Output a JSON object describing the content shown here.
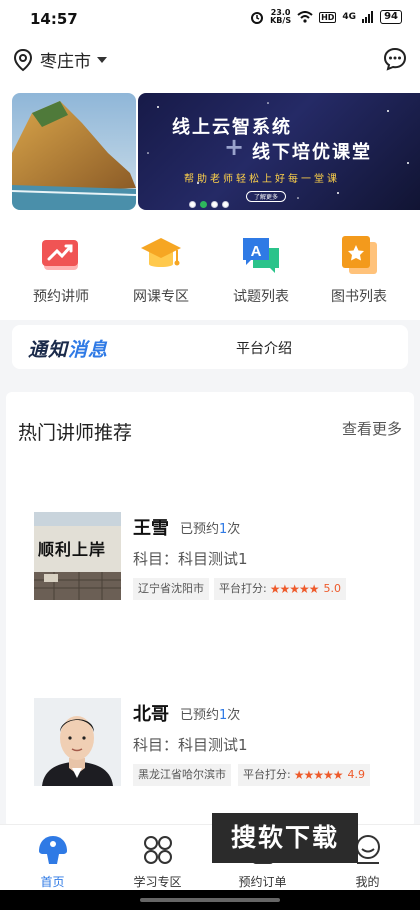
{
  "status_bar": {
    "time": "14:57",
    "net_speed_value": "23.0",
    "net_speed_unit": "KB/S",
    "hd": "HD",
    "signal": "4G",
    "battery": "94"
  },
  "header": {
    "city": "枣庄市",
    "icons": [
      "location-pin-icon",
      "caret-down-icon",
      "chat-bubble-icon"
    ]
  },
  "banner": {
    "title_line1": "线上云智系统",
    "title_line2": "线下培优课堂",
    "subtitle": "帮助老师轻松上好每一堂课",
    "button": "了解更多",
    "slide_count": 4,
    "active_slide": 1
  },
  "quick_nav": {
    "items": [
      {
        "label": "预约讲师",
        "icon": "trend-chart-icon",
        "color": "#f05454"
      },
      {
        "label": "网课专区",
        "icon": "graduation-cap-icon",
        "color": "#f6a623"
      },
      {
        "label": "试题列表",
        "icon": "quiz-chat-icon",
        "color": "#2f7ae5"
      },
      {
        "label": "图书列表",
        "icon": "book-star-icon",
        "color": "#f39a1c"
      }
    ]
  },
  "notice": {
    "logo_part1": "通知",
    "logo_part2": "消息",
    "text": "平台介绍"
  },
  "hot_teachers": {
    "title": "热门讲师推荐",
    "more": "查看更多",
    "teachers": [
      {
        "name": "王雪",
        "booked_prefix": "已预约",
        "booked_count": "1",
        "booked_suffix": "次",
        "subject": "科目：科目测试1",
        "location": "辽宁省沈阳市",
        "score_label": "平台打分:",
        "score": "5.0",
        "stars": 5,
        "photo_text": "顺利上岸"
      },
      {
        "name": "北哥",
        "booked_prefix": "已预约",
        "booked_count": "1",
        "booked_suffix": "次",
        "subject": "科目：科目测试1",
        "location": "黑龙江省哈尔滨市",
        "score_label": "平台打分:",
        "score": "4.9",
        "stars": 5
      }
    ]
  },
  "tab_bar": {
    "tabs": [
      {
        "label": "首页",
        "icon": "home-mushroom-icon",
        "active": true
      },
      {
        "label": "学习专区",
        "icon": "grid-shapes-icon",
        "active": false
      },
      {
        "label": "预约订单",
        "icon": "order-icon",
        "active": false
      },
      {
        "label": "我的",
        "icon": "profile-smile-icon",
        "active": false
      }
    ]
  },
  "watermark": "搜软下载",
  "colors": {
    "accent": "#2f7ae5",
    "score": "#ee5a2b",
    "active_dot": "#2eb85c"
  }
}
